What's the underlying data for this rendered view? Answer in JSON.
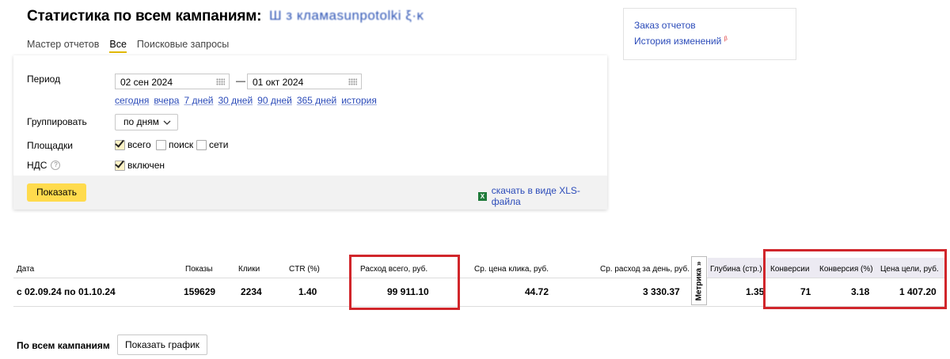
{
  "header": {
    "title": "Статистика по всем кампаниям:",
    "campaign_name_blurred": "Ш з кламаsunpotolki ξ·κ"
  },
  "tabs": [
    {
      "label": "Мастер отчетов",
      "active": false
    },
    {
      "label": "Все",
      "active": true
    },
    {
      "label": "Поисковые запросы",
      "active": false
    }
  ],
  "filters": {
    "period_label": "Период",
    "date_from": "02 сен 2024",
    "date_dash": "—",
    "date_to": "01 окт 2024",
    "quick_ranges": [
      "сегодня",
      "вчера",
      "7 дней",
      "30 дней",
      "90 дней",
      "365 дней",
      "история"
    ],
    "group_label": "Группировать",
    "group_value": "по дням",
    "platforms_label": "Площадки",
    "platforms": [
      {
        "label": "всего",
        "checked": true
      },
      {
        "label": "поиск",
        "checked": false
      },
      {
        "label": "сети",
        "checked": false
      }
    ],
    "vat_label": "НДС",
    "vat_help": "?",
    "vat_option": "включен",
    "vat_checked": true,
    "show_button": "Показать",
    "xls_link": "скачать в виде XLS-файла",
    "xls_icon": "X"
  },
  "side_links": {
    "order_reports": "Заказ отчетов",
    "change_history": "История изменений",
    "beta": "β"
  },
  "table": {
    "headers": {
      "date": "Дата",
      "impressions": "Показы",
      "clicks": "Клики",
      "ctr": "CTR (%)",
      "spend": "Расход всего, руб.",
      "cpc": "Ср. цена клика, руб.",
      "daily": "Ср. расход за день, руб.",
      "metrika": "Метрика »",
      "depth": "Глубина (стр.)",
      "conversions": "Конверсии",
      "conv_rate": "Конверсия (%)",
      "goal_cost": "Цена цели, руб."
    },
    "row": {
      "date": "с 02.09.24 по 01.10.24",
      "impressions": "159629",
      "clicks": "2234",
      "ctr": "1.40",
      "spend": "99 911.10",
      "cpc": "44.72",
      "daily": "3 330.37",
      "depth": "1.35",
      "conversions": "71",
      "conv_rate": "3.18",
      "goal_cost": "1 407.20"
    }
  },
  "bottom": {
    "label": "По всем кампаниям",
    "graph_button": "Показать график"
  },
  "colors": {
    "link": "#2b4bb9",
    "highlight_box": "#d1262b",
    "button_yellow": "#ffdb4d"
  }
}
